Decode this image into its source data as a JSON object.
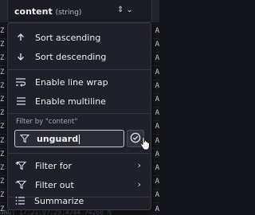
{
  "column": {
    "name": "content",
    "type": "(string)"
  },
  "table_rows": {
    "left": [
      "Z",
      "Z",
      "Z",
      "Z",
      "Z",
      "Z",
      "Z",
      "Z",
      "Z",
      "Z",
      "Z",
      "Z",
      "Z",
      "Z"
    ],
    "right": [
      "A",
      "A",
      "A",
      "A",
      "A",
      "A",
      "A",
      "A",
      "A",
      "A",
      "A",
      "A",
      "A",
      "A"
    ],
    "bottom_row": "JNG] 17:21:07:29:4744  74260 N"
  },
  "menu": {
    "sort_ascending": "Sort ascending",
    "sort_descending": "Sort descending",
    "enable_line_wrap": "Enable line wrap",
    "enable_multiline": "Enable multiline",
    "filter_section_label": "Filter by \"content\"",
    "filter_value": "unguard",
    "filter_for": "Filter for",
    "filter_out": "Filter out",
    "summarize": "Summarize"
  },
  "colors": {
    "menu_bg": "#1f2029",
    "page_bg": "#15161c",
    "input_border": "#c9cbd8"
  }
}
